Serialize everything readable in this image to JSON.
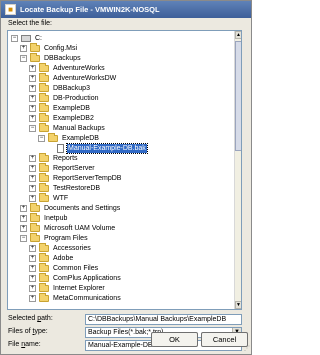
{
  "window": {
    "title": "Locate Backup File - VMWIN2K-NOSQL",
    "select_label": "Select the file:"
  },
  "tree": {
    "items": [
      {
        "label": "C:",
        "level": 0,
        "expander": "-",
        "icon": "drive"
      },
      {
        "label": "Config.Msi",
        "level": 1,
        "expander": "+",
        "icon": "folder"
      },
      {
        "label": "DBBackups",
        "level": 1,
        "expander": "-",
        "icon": "folder"
      },
      {
        "label": "AdventureWorks",
        "level": 2,
        "expander": "+",
        "icon": "folder"
      },
      {
        "label": "AdventureWorksDW",
        "level": 2,
        "expander": "+",
        "icon": "folder"
      },
      {
        "label": "DBBackup3",
        "level": 2,
        "expander": "+",
        "icon": "folder"
      },
      {
        "label": "DB-Production",
        "level": 2,
        "expander": "+",
        "icon": "folder"
      },
      {
        "label": "ExampleDB",
        "level": 2,
        "expander": "+",
        "icon": "folder"
      },
      {
        "label": "ExampleDB2",
        "level": 2,
        "expander": "+",
        "icon": "folder"
      },
      {
        "label": "Manual Backups",
        "level": 2,
        "expander": "-",
        "icon": "folder"
      },
      {
        "label": "ExampleDB",
        "level": 3,
        "expander": "-",
        "icon": "folder"
      },
      {
        "label": "Manual-Example-DB.bak",
        "level": 4,
        "expander": "",
        "icon": "file",
        "selected": true
      },
      {
        "label": "Reports",
        "level": 2,
        "expander": "+",
        "icon": "folder"
      },
      {
        "label": "ReportServer",
        "level": 2,
        "expander": "+",
        "icon": "folder"
      },
      {
        "label": "ReportServerTempDB",
        "level": 2,
        "expander": "+",
        "icon": "folder"
      },
      {
        "label": "TestRestoreDB",
        "level": 2,
        "expander": "+",
        "icon": "folder"
      },
      {
        "label": "WTF",
        "level": 2,
        "expander": "+",
        "icon": "folder"
      },
      {
        "label": "Documents and Settings",
        "level": 1,
        "expander": "+",
        "icon": "folder"
      },
      {
        "label": "Inetpub",
        "level": 1,
        "expander": "+",
        "icon": "folder"
      },
      {
        "label": "Microsoft UAM Volume",
        "level": 1,
        "expander": "+",
        "icon": "folder"
      },
      {
        "label": "Program Files",
        "level": 1,
        "expander": "-",
        "icon": "folder"
      },
      {
        "label": "Accessories",
        "level": 2,
        "expander": "+",
        "icon": "folder"
      },
      {
        "label": "Adobe",
        "level": 2,
        "expander": "+",
        "icon": "folder"
      },
      {
        "label": "Common Files",
        "level": 2,
        "expander": "+",
        "icon": "folder"
      },
      {
        "label": "ComPlus Applications",
        "level": 2,
        "expander": "+",
        "icon": "folder"
      },
      {
        "label": "Internet Explorer",
        "level": 2,
        "expander": "+",
        "icon": "folder"
      },
      {
        "label": "MetaCommunications",
        "level": 2,
        "expander": "+",
        "icon": "folder"
      }
    ]
  },
  "fields": {
    "selected_path_label_pre": "Selected ",
    "selected_path_label_key": "p",
    "selected_path_label_post": "ath:",
    "selected_path_value": "C:\\DBBackups\\Manual Backups\\ExampleDB",
    "files_of_type_label_pre": "Files of ",
    "files_of_type_label_key": "t",
    "files_of_type_label_post": "ype:",
    "files_of_type_value": "Backup Files(*.bak;*.trn)",
    "file_name_label_pre": "File ",
    "file_name_label_key": "n",
    "file_name_label_post": "ame:",
    "file_name_value": "Manual-Example-DB.bak"
  },
  "buttons": {
    "ok": "OK",
    "cancel": "Cancel"
  },
  "colors": {
    "selection": "#316ac5",
    "title_bar": "#3d5f99"
  }
}
